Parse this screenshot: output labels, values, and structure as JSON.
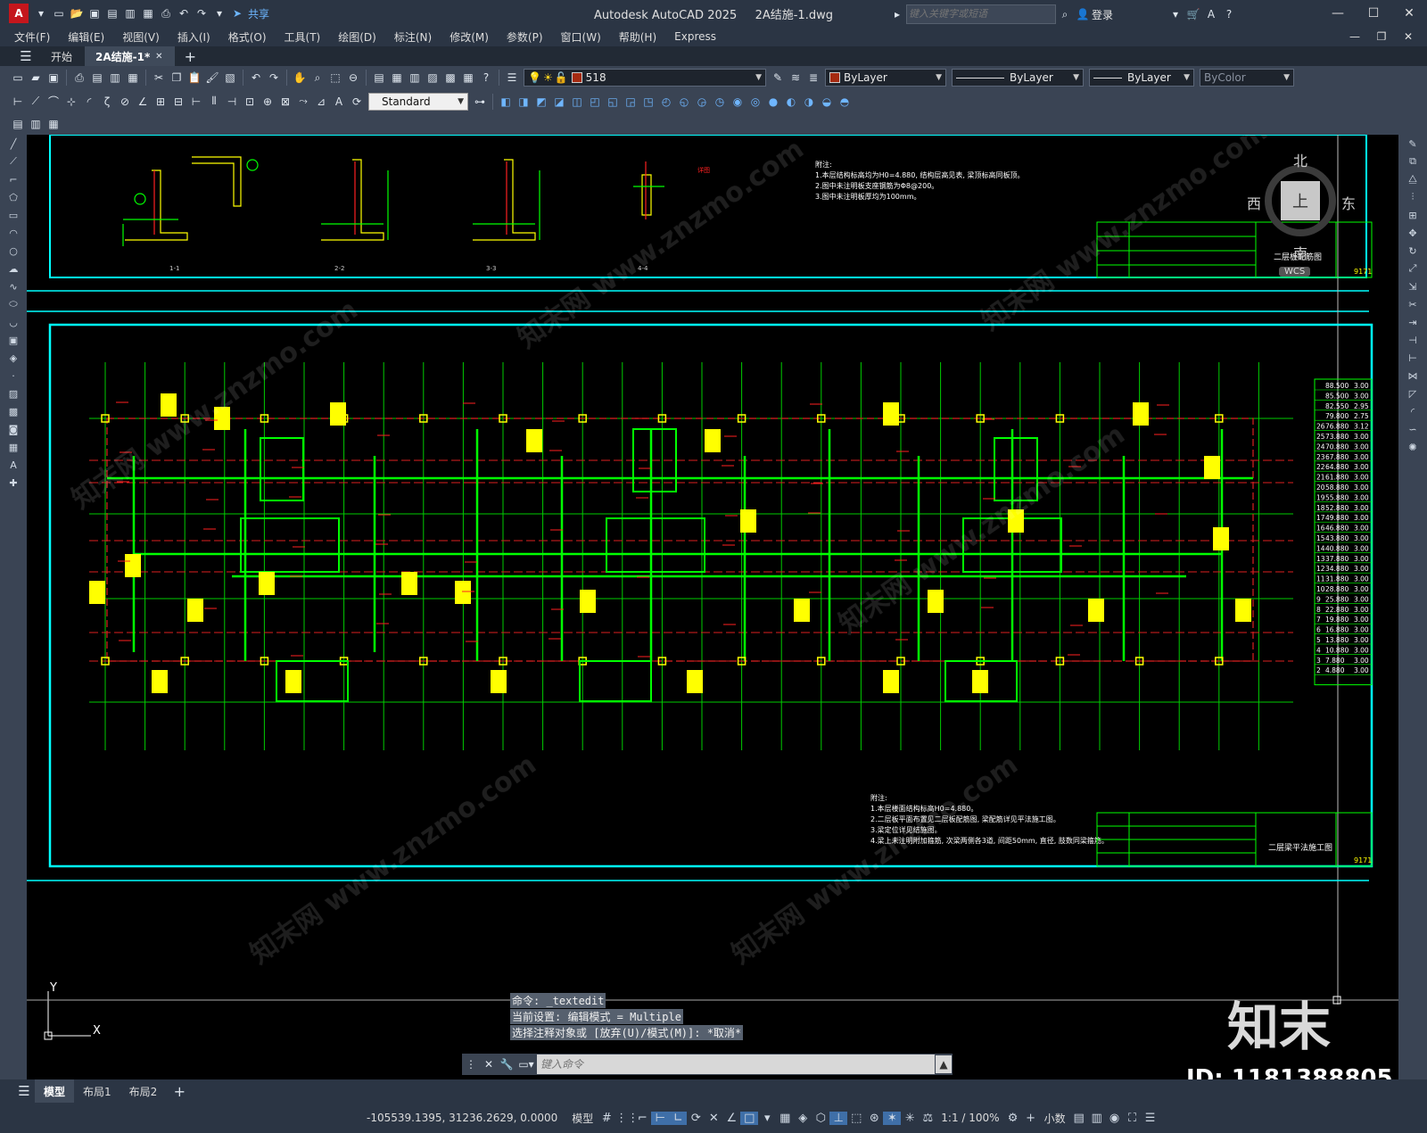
{
  "app": {
    "title": "Autodesk AutoCAD 2025",
    "document": "2A结施-1.dwg",
    "search_placeholder": "键入关键字或短语",
    "login": "登录",
    "share": "共享",
    "app_button": "A"
  },
  "menu": [
    "文件(F)",
    "编辑(E)",
    "视图(V)",
    "插入(I)",
    "格式(O)",
    "工具(T)",
    "绘图(D)",
    "标注(N)",
    "修改(M)",
    "参数(P)",
    "窗口(W)",
    "帮助(H)",
    "Express"
  ],
  "tabs": {
    "start": "开始",
    "active": "2A结施-1*"
  },
  "layer": {
    "name": "518",
    "color": "#a52a10"
  },
  "properties": {
    "color": "ByLayer",
    "linetype": "ByLayer",
    "lineweight": "ByLayer",
    "plotstyle": "ByColor"
  },
  "dimstyle": "Standard",
  "viewcube": {
    "north": "北",
    "south": "南",
    "east": "东",
    "west": "西",
    "top": "上",
    "wcs": "WCS"
  },
  "command": {
    "history": [
      "命令: _textedit",
      "当前设置: 编辑模式 = Multiple",
      "选择注释对象或 [放弃(U)/模式(M)]: *取消*"
    ],
    "placeholder": "键入命令"
  },
  "layouts": [
    "模型",
    "布局1",
    "布局2"
  ],
  "status": {
    "coords": "-105539.1395, 31236.2629, 0.0000",
    "mode": "模型",
    "scale": "1:1 / 100%",
    "units": "小数"
  },
  "drawing": {
    "notes_title": "附注:",
    "notes_lines": [
      "1.本层结构标高均为H0=4.880, 结构层高见表, 梁顶标高同板顶。",
      "2.图中未注明板支座钢筋为Φ8@200。",
      "3.图中未注明板厚均为100mm。"
    ],
    "notes2_title": "附注:",
    "notes2_lines": [
      "1.本层楼面结构标高H0=4.880。",
      "2.二层板平面布置见二层板配筋图, 梁配筋详见平法施工图。",
      "3.梁定位详见结施图。",
      "4.梁上未注明附加箍筋, 次梁两侧各3道, 间距50mm, 直径, 肢数同梁箍筋。"
    ],
    "title1": "二层板配筋图",
    "title2": "二层梁平法施工图",
    "sheet": "9171",
    "floor_rows": [
      [
        "",
        "88.500",
        "3.00"
      ],
      [
        "",
        "85.500",
        "3.00"
      ],
      [
        "",
        "82.550",
        "2.95"
      ],
      [
        "",
        "79.800",
        "2.75"
      ],
      [
        "26",
        "76.880",
        "3.12"
      ],
      [
        "25",
        "73.880",
        "3.00"
      ],
      [
        "24",
        "70.880",
        "3.00"
      ],
      [
        "23",
        "67.880",
        "3.00"
      ],
      [
        "22",
        "64.880",
        "3.00"
      ],
      [
        "21",
        "61.880",
        "3.00"
      ],
      [
        "20",
        "58.880",
        "3.00"
      ],
      [
        "19",
        "55.880",
        "3.00"
      ],
      [
        "18",
        "52.880",
        "3.00"
      ],
      [
        "17",
        "49.880",
        "3.00"
      ],
      [
        "16",
        "46.880",
        "3.00"
      ],
      [
        "15",
        "43.880",
        "3.00"
      ],
      [
        "14",
        "40.880",
        "3.00"
      ],
      [
        "13",
        "37.880",
        "3.00"
      ],
      [
        "12",
        "34.880",
        "3.00"
      ],
      [
        "11",
        "31.880",
        "3.00"
      ],
      [
        "10",
        "28.880",
        "3.00"
      ],
      [
        "9",
        "25.880",
        "3.00"
      ],
      [
        "8",
        "22.880",
        "3.00"
      ],
      [
        "7",
        "19.880",
        "3.00"
      ],
      [
        "6",
        "16.880",
        "3.00"
      ],
      [
        "5",
        "13.880",
        "3.00"
      ],
      [
        "4",
        "10.880",
        "3.00"
      ],
      [
        "3",
        "7.880",
        "3.00"
      ],
      [
        "2",
        "4.880",
        "3.00"
      ]
    ],
    "watermark": "知末网 www.znzmo.com",
    "brand": "知末",
    "brand_id": "ID: 1181388805",
    "axis_y": "Y",
    "axis_x": "X"
  }
}
